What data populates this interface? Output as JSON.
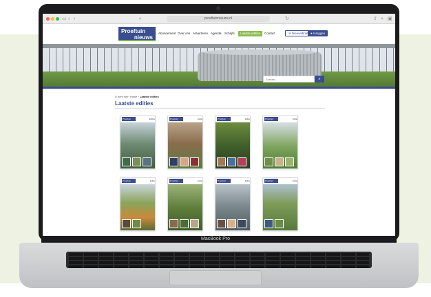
{
  "device": {
    "label": "MacBook Pro"
  },
  "browser": {
    "address": "proeftuinnieuws.nl",
    "traffic_lights": [
      "#ff5f57",
      "#febc2e",
      "#28c840"
    ],
    "icons": [
      "sidebar-icon",
      "back-icon",
      "forward-icon",
      "shield-icon",
      "reload-icon",
      "share-icon",
      "new-tab-icon",
      "tabs-icon"
    ]
  },
  "site": {
    "logo_line1": "Proeftuin",
    "logo_line2": "nieuws",
    "nav": [
      "Abonnement",
      "Over ons",
      "Adverteren",
      "Agenda",
      "Schrijfs",
      "Laatste edities",
      "Contact"
    ],
    "active_nav": "Laatste edities",
    "btn_newsletter": "Nieuwsbrief",
    "btn_login": "Inloggen",
    "search_placeholder": "Zoeken...",
    "search_icon": "magnifier-icon",
    "brand_color": "#3a4d8f",
    "accent_color": "#8dbb52"
  },
  "breadcrumb": {
    "home": "U bent hier:",
    "parent": "Home",
    "current": "Laatste edities"
  },
  "page_title": "Laatste edities",
  "covers": [
    {
      "logo": "Proeftuin nieuws",
      "tag": "Edities",
      "theme": "greenhouse"
    },
    {
      "logo": "Proeftuin nieuws",
      "tag": "Editie",
      "theme": "field-workers"
    },
    {
      "logo": "Proeftuin nieuws",
      "tag": "Editie",
      "theme": "vine-crop"
    },
    {
      "logo": "Proeftuin nieuws",
      "tag": "Editie",
      "theme": "lettuce-hall"
    },
    {
      "logo": "Proeftuin nieuws",
      "tag": "Editie",
      "theme": "flower-field"
    },
    {
      "logo": "Proeftuin nieuws",
      "tag": "Editie",
      "theme": "farm-land"
    },
    {
      "logo": "Proeftuin nieuws",
      "tag": "Editie",
      "theme": "tractor-mist"
    },
    {
      "logo": "Proeftuin nieuws",
      "tag": "Editie",
      "theme": "harvest-rows"
    }
  ]
}
